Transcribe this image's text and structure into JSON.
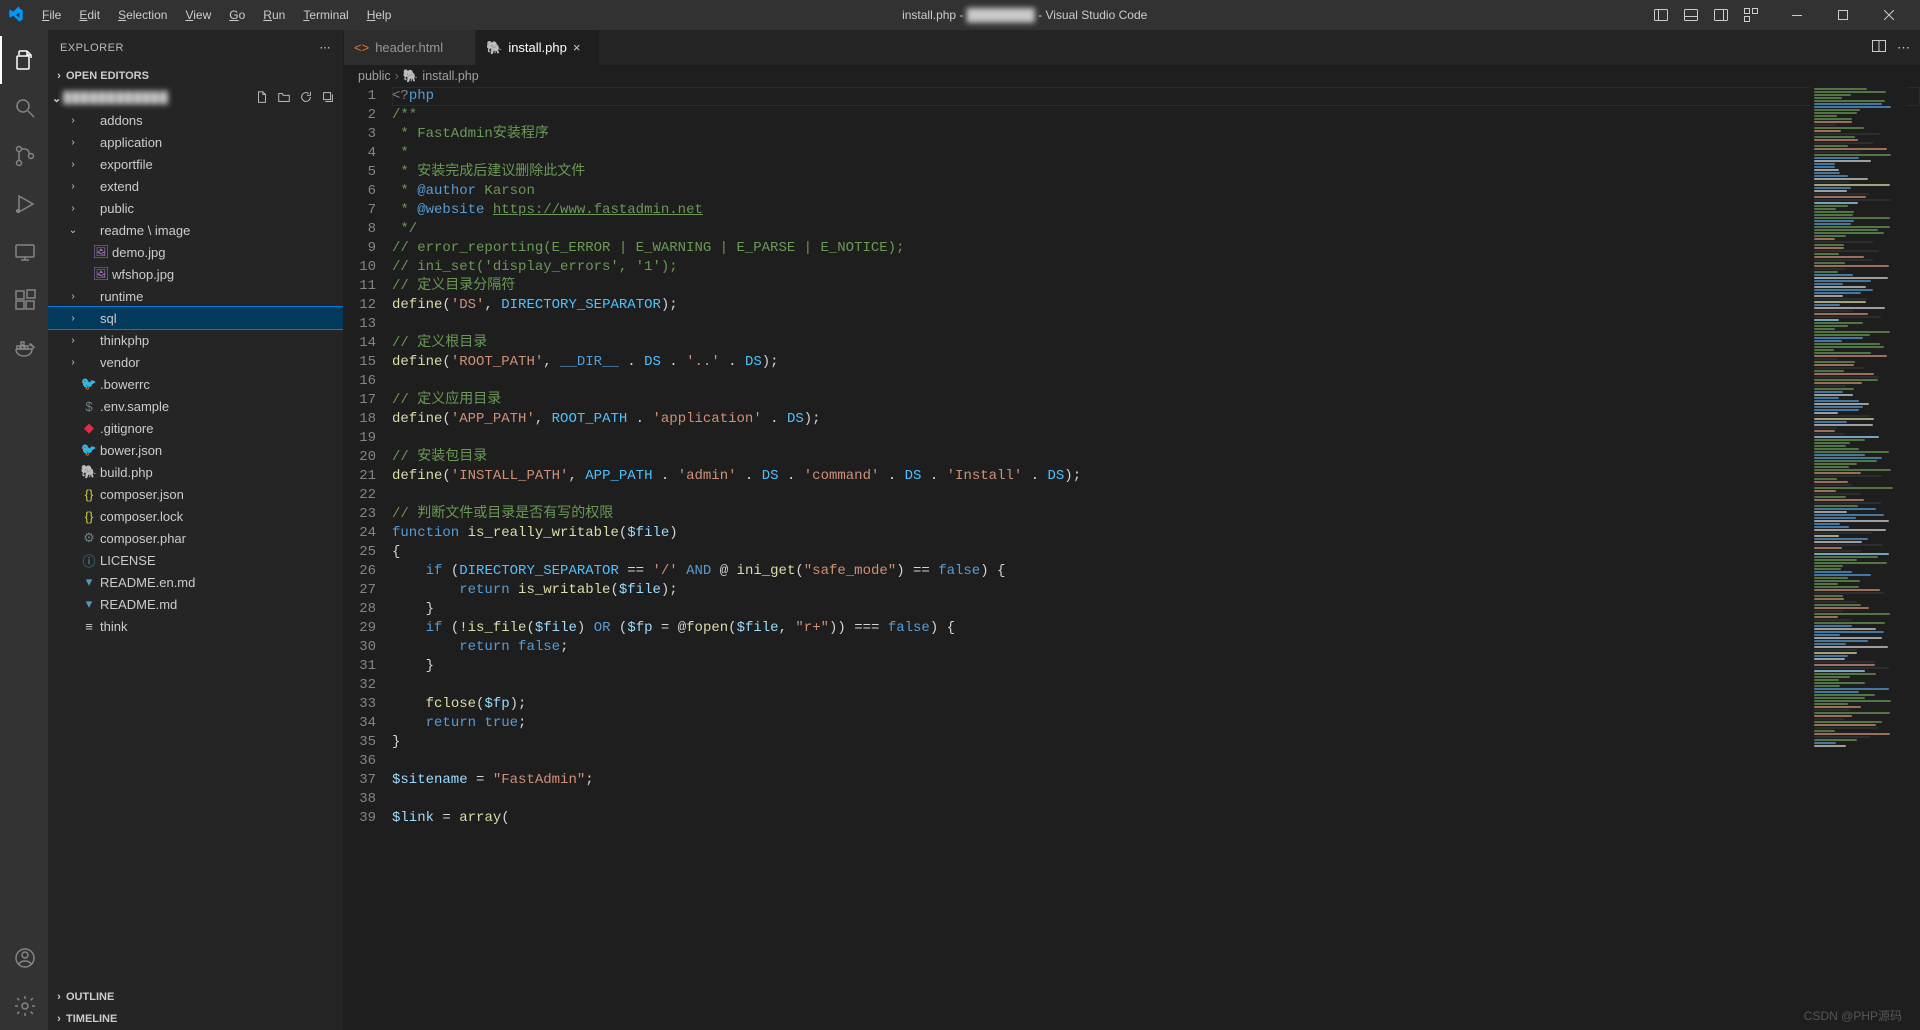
{
  "titlebar": {
    "menus": [
      "File",
      "Edit",
      "Selection",
      "View",
      "Go",
      "Run",
      "Terminal",
      "Help"
    ],
    "title_prefix": "install.php - ",
    "title_blurred": "████████",
    "title_suffix": " - Visual Studio Code"
  },
  "sidebar": {
    "title": "EXPLORER",
    "openEditorsLabel": "OPEN EDITORS",
    "outlineLabel": "OUTLINE",
    "timelineLabel": "TIMELINE",
    "rootBlurred": "████████████",
    "tree": [
      {
        "type": "folder",
        "label": "addons",
        "open": false,
        "depth": 1
      },
      {
        "type": "folder",
        "label": "application",
        "open": false,
        "depth": 1
      },
      {
        "type": "folder",
        "label": "exportfile",
        "open": false,
        "depth": 1
      },
      {
        "type": "folder",
        "label": "extend",
        "open": false,
        "depth": 1
      },
      {
        "type": "folder",
        "label": "public",
        "open": false,
        "depth": 1
      },
      {
        "type": "folder",
        "label": "readme \\ image",
        "open": true,
        "depth": 1
      },
      {
        "type": "file",
        "label": "demo.jpg",
        "icon": "img",
        "depth": 2
      },
      {
        "type": "file",
        "label": "wfshop.jpg",
        "icon": "img",
        "depth": 2
      },
      {
        "type": "folder",
        "label": "runtime",
        "open": false,
        "depth": 1
      },
      {
        "type": "folder",
        "label": "sql",
        "open": false,
        "depth": 1,
        "selected": true
      },
      {
        "type": "folder",
        "label": "thinkphp",
        "open": false,
        "depth": 1
      },
      {
        "type": "folder",
        "label": "vendor",
        "open": false,
        "depth": 1
      },
      {
        "type": "file",
        "label": ".bowerrc",
        "icon": "bower",
        "depth": 1
      },
      {
        "type": "file",
        "label": ".env.sample",
        "icon": "env",
        "depth": 1
      },
      {
        "type": "file",
        "label": ".gitignore",
        "icon": "git",
        "depth": 1
      },
      {
        "type": "file",
        "label": "bower.json",
        "icon": "bower",
        "depth": 1
      },
      {
        "type": "file",
        "label": "build.php",
        "icon": "php",
        "depth": 1
      },
      {
        "type": "file",
        "label": "composer.json",
        "icon": "json",
        "depth": 1
      },
      {
        "type": "file",
        "label": "composer.lock",
        "icon": "json",
        "depth": 1
      },
      {
        "type": "file",
        "label": "composer.phar",
        "icon": "cog",
        "depth": 1
      },
      {
        "type": "file",
        "label": "LICENSE",
        "icon": "info",
        "depth": 1
      },
      {
        "type": "file",
        "label": "README.en.md",
        "icon": "md",
        "depth": 1
      },
      {
        "type": "file",
        "label": "README.md",
        "icon": "md",
        "depth": 1
      },
      {
        "type": "file",
        "label": "think",
        "icon": "text",
        "depth": 1
      }
    ]
  },
  "tabs": [
    {
      "label": "header.html",
      "icon": "html",
      "active": false
    },
    {
      "label": "install.php",
      "icon": "php",
      "active": true
    }
  ],
  "breadcrumb": {
    "parts": [
      "public",
      "install.php"
    ],
    "icon": "php"
  },
  "code": {
    "lines": [
      [
        {
          "t": "<?",
          "c": "tk-tag"
        },
        {
          "t": "php",
          "c": "tk-php"
        }
      ],
      [
        {
          "t": "/**",
          "c": "tk-c2"
        }
      ],
      [
        {
          "t": " * FastAdmin安装程序",
          "c": "tk-c2"
        }
      ],
      [
        {
          "t": " *",
          "c": "tk-c2"
        }
      ],
      [
        {
          "t": " * 安装完成后建议删除此文件",
          "c": "tk-c2"
        }
      ],
      [
        {
          "t": " * ",
          "c": "tk-c2"
        },
        {
          "t": "@author",
          "c": "tk-kw"
        },
        {
          "t": " Karson",
          "c": "tk-c2"
        }
      ],
      [
        {
          "t": " * ",
          "c": "tk-c2"
        },
        {
          "t": "@website",
          "c": "tk-kw"
        },
        {
          "t": " ",
          "c": ""
        },
        {
          "t": "https://www.fastadmin.net",
          "c": "tk-url",
          "url": true
        }
      ],
      [
        {
          "t": " */",
          "c": "tk-c2"
        }
      ],
      [
        {
          "t": "// error_reporting(E_ERROR | E_WARNING | E_PARSE | E_NOTICE);",
          "c": "tk-c1"
        }
      ],
      [
        {
          "t": "// ini_set('display_errors', '1');",
          "c": "tk-c1"
        }
      ],
      [
        {
          "t": "// 定义目录分隔符",
          "c": "tk-c1"
        }
      ],
      [
        {
          "t": "define",
          "c": "tk-fn"
        },
        {
          "t": "(",
          "c": ""
        },
        {
          "t": "'DS'",
          "c": "tk-str"
        },
        {
          "t": ", ",
          "c": ""
        },
        {
          "t": "DIRECTORY_SEPARATOR",
          "c": "tk-const"
        },
        {
          "t": ");",
          "c": ""
        }
      ],
      [
        {
          "t": "",
          "c": ""
        }
      ],
      [
        {
          "t": "// 定义根目录",
          "c": "tk-c1"
        }
      ],
      [
        {
          "t": "define",
          "c": "tk-fn"
        },
        {
          "t": "(",
          "c": ""
        },
        {
          "t": "'ROOT_PATH'",
          "c": "tk-str"
        },
        {
          "t": ", ",
          "c": ""
        },
        {
          "t": "__DIR__",
          "c": "tk-kw"
        },
        {
          "t": " . ",
          "c": ""
        },
        {
          "t": "DS",
          "c": "tk-const"
        },
        {
          "t": " . ",
          "c": ""
        },
        {
          "t": "'..'",
          "c": "tk-str"
        },
        {
          "t": " . ",
          "c": ""
        },
        {
          "t": "DS",
          "c": "tk-const"
        },
        {
          "t": ");",
          "c": ""
        }
      ],
      [
        {
          "t": "",
          "c": ""
        }
      ],
      [
        {
          "t": "// 定义应用目录",
          "c": "tk-c1"
        }
      ],
      [
        {
          "t": "define",
          "c": "tk-fn"
        },
        {
          "t": "(",
          "c": ""
        },
        {
          "t": "'APP_PATH'",
          "c": "tk-str"
        },
        {
          "t": ", ",
          "c": ""
        },
        {
          "t": "ROOT_PATH",
          "c": "tk-const"
        },
        {
          "t": " . ",
          "c": ""
        },
        {
          "t": "'application'",
          "c": "tk-str"
        },
        {
          "t": " . ",
          "c": ""
        },
        {
          "t": "DS",
          "c": "tk-const"
        },
        {
          "t": ");",
          "c": ""
        }
      ],
      [
        {
          "t": "",
          "c": ""
        }
      ],
      [
        {
          "t": "// 安装包目录",
          "c": "tk-c1"
        }
      ],
      [
        {
          "t": "define",
          "c": "tk-fn"
        },
        {
          "t": "(",
          "c": ""
        },
        {
          "t": "'INSTALL_PATH'",
          "c": "tk-str"
        },
        {
          "t": ", ",
          "c": ""
        },
        {
          "t": "APP_PATH",
          "c": "tk-const"
        },
        {
          "t": " . ",
          "c": ""
        },
        {
          "t": "'admin'",
          "c": "tk-str"
        },
        {
          "t": " . ",
          "c": ""
        },
        {
          "t": "DS",
          "c": "tk-const"
        },
        {
          "t": " . ",
          "c": ""
        },
        {
          "t": "'command'",
          "c": "tk-str"
        },
        {
          "t": " . ",
          "c": ""
        },
        {
          "t": "DS",
          "c": "tk-const"
        },
        {
          "t": " . ",
          "c": ""
        },
        {
          "t": "'Install'",
          "c": "tk-str"
        },
        {
          "t": " . ",
          "c": ""
        },
        {
          "t": "DS",
          "c": "tk-const"
        },
        {
          "t": ");",
          "c": ""
        }
      ],
      [
        {
          "t": "",
          "c": ""
        }
      ],
      [
        {
          "t": "// 判断文件或目录是否有写的权限",
          "c": "tk-c1"
        }
      ],
      [
        {
          "t": "function",
          "c": "tk-kw"
        },
        {
          "t": " ",
          "c": ""
        },
        {
          "t": "is_really_writable",
          "c": "tk-fn"
        },
        {
          "t": "(",
          "c": ""
        },
        {
          "t": "$file",
          "c": "tk-var"
        },
        {
          "t": ")",
          "c": ""
        }
      ],
      [
        {
          "t": "{",
          "c": ""
        }
      ],
      [
        {
          "t": "    ",
          "c": ""
        },
        {
          "t": "if",
          "c": "tk-kw"
        },
        {
          "t": " (",
          "c": ""
        },
        {
          "t": "DIRECTORY_SEPARATOR",
          "c": "tk-const"
        },
        {
          "t": " == ",
          "c": ""
        },
        {
          "t": "'/'",
          "c": "tk-str"
        },
        {
          "t": " ",
          "c": ""
        },
        {
          "t": "AND",
          "c": "tk-kw"
        },
        {
          "t": " @ ",
          "c": ""
        },
        {
          "t": "ini_get",
          "c": "tk-fn"
        },
        {
          "t": "(",
          "c": ""
        },
        {
          "t": "\"safe_mode\"",
          "c": "tk-str"
        },
        {
          "t": ") == ",
          "c": ""
        },
        {
          "t": "false",
          "c": "tk-kw"
        },
        {
          "t": ") {",
          "c": ""
        }
      ],
      [
        {
          "t": "        ",
          "c": ""
        },
        {
          "t": "return",
          "c": "tk-kw"
        },
        {
          "t": " ",
          "c": ""
        },
        {
          "t": "is_writable",
          "c": "tk-fn"
        },
        {
          "t": "(",
          "c": ""
        },
        {
          "t": "$file",
          "c": "tk-var"
        },
        {
          "t": ");",
          "c": ""
        }
      ],
      [
        {
          "t": "    }",
          "c": ""
        }
      ],
      [
        {
          "t": "    ",
          "c": ""
        },
        {
          "t": "if",
          "c": "tk-kw"
        },
        {
          "t": " (!",
          "c": ""
        },
        {
          "t": "is_file",
          "c": "tk-fn"
        },
        {
          "t": "(",
          "c": ""
        },
        {
          "t": "$file",
          "c": "tk-var"
        },
        {
          "t": ") ",
          "c": ""
        },
        {
          "t": "OR",
          "c": "tk-kw"
        },
        {
          "t": " (",
          "c": ""
        },
        {
          "t": "$fp",
          "c": "tk-var"
        },
        {
          "t": " = @",
          "c": ""
        },
        {
          "t": "fopen",
          "c": "tk-fn"
        },
        {
          "t": "(",
          "c": ""
        },
        {
          "t": "$file",
          "c": "tk-var"
        },
        {
          "t": ", ",
          "c": ""
        },
        {
          "t": "\"r+\"",
          "c": "tk-str"
        },
        {
          "t": ")) === ",
          "c": ""
        },
        {
          "t": "false",
          "c": "tk-kw"
        },
        {
          "t": ") {",
          "c": ""
        }
      ],
      [
        {
          "t": "        ",
          "c": ""
        },
        {
          "t": "return",
          "c": "tk-kw"
        },
        {
          "t": " ",
          "c": ""
        },
        {
          "t": "false",
          "c": "tk-kw"
        },
        {
          "t": ";",
          "c": ""
        }
      ],
      [
        {
          "t": "    }",
          "c": ""
        }
      ],
      [
        {
          "t": "",
          "c": ""
        }
      ],
      [
        {
          "t": "    ",
          "c": ""
        },
        {
          "t": "fclose",
          "c": "tk-fn"
        },
        {
          "t": "(",
          "c": ""
        },
        {
          "t": "$fp",
          "c": "tk-var"
        },
        {
          "t": ");",
          "c": ""
        }
      ],
      [
        {
          "t": "    ",
          "c": ""
        },
        {
          "t": "return",
          "c": "tk-kw"
        },
        {
          "t": " ",
          "c": ""
        },
        {
          "t": "true",
          "c": "tk-kw"
        },
        {
          "t": ";",
          "c": ""
        }
      ],
      [
        {
          "t": "}",
          "c": ""
        }
      ],
      [
        {
          "t": "",
          "c": ""
        }
      ],
      [
        {
          "t": "$sitename",
          "c": "tk-var"
        },
        {
          "t": " = ",
          "c": ""
        },
        {
          "t": "\"FastAdmin\"",
          "c": "tk-str"
        },
        {
          "t": ";",
          "c": ""
        }
      ],
      [
        {
          "t": "",
          "c": ""
        }
      ],
      [
        {
          "t": "$link",
          "c": "tk-var"
        },
        {
          "t": " = ",
          "c": ""
        },
        {
          "t": "array",
          "c": "tk-fn"
        },
        {
          "t": "(",
          "c": ""
        }
      ]
    ]
  },
  "watermark": "CSDN @PHP源码"
}
